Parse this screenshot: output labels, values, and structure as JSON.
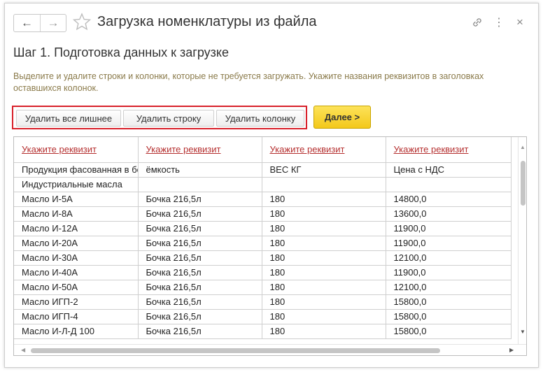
{
  "window": {
    "title": "Загрузка номенклатуры из файла",
    "back_glyph": "←",
    "forward_glyph": "→",
    "link_glyph": "🔗",
    "more_glyph": "⋮",
    "close_glyph": "×"
  },
  "step_title": "Шаг 1. Подготовка данных к загрузке",
  "hint": "Выделите и удалите строки и колонки, которые не требуется загружать. Укажите названия реквизитов в заголовках оставшихся колонок.",
  "toolbar": {
    "delete_all_extra": "Удалить все лишнее",
    "delete_row": "Удалить строку",
    "delete_column": "Удалить колонку",
    "next": "Далее >"
  },
  "colors": {
    "highlight_frame": "#d8202a",
    "next_button": "#f3c81a",
    "header_link": "#b53030",
    "hint_text": "#8a7a4a"
  },
  "table": {
    "headers": [
      "Укажите реквизит",
      "Укажите реквизит",
      "Укажите реквизит",
      "Укажите реквизит"
    ],
    "rows": [
      [
        "Продукция фасованная в бочки",
        "ёмкость",
        "ВЕС КГ",
        "Цена с НДС"
      ],
      [
        "Индустриальные масла",
        "",
        "",
        ""
      ],
      [
        "Масло И-5А",
        "Бочка 216,5л",
        "180",
        "14800,0"
      ],
      [
        "Масло И-8А",
        "Бочка 216,5л",
        "180",
        "13600,0"
      ],
      [
        "Масло И-12А",
        "Бочка 216,5л",
        "180",
        "11900,0"
      ],
      [
        "Масло И-20А",
        "Бочка 216,5л",
        "180",
        "11900,0"
      ],
      [
        "Масло И-30А",
        "Бочка 216,5л",
        "180",
        "12100,0"
      ],
      [
        "Масло И-40А",
        "Бочка 216,5л",
        "180",
        "11900,0"
      ],
      [
        "Масло И-50А",
        "Бочка 216,5л",
        "180",
        "12100,0"
      ],
      [
        "Масло ИГП-2",
        "Бочка 216,5л",
        "180",
        "15800,0"
      ],
      [
        "Масло ИГП-4",
        "Бочка 216,5л",
        "180",
        "15800,0"
      ],
      [
        "Масло И-Л-Д 100",
        "Бочка 216,5л",
        "180",
        "15800,0"
      ]
    ]
  }
}
